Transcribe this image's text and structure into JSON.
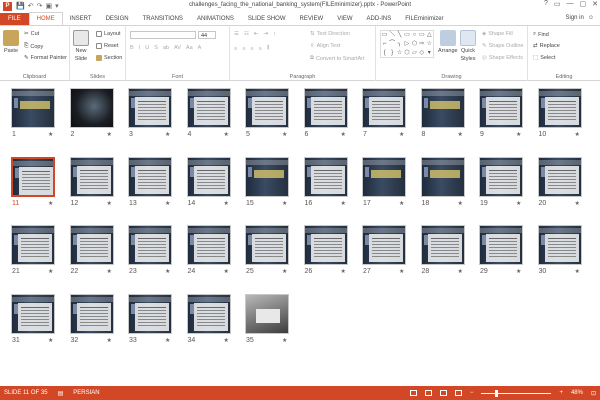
{
  "window": {
    "title": "challenges_facing_the_national_banking_system(FILEminimizer).pptx - PowerPoint",
    "app_icon": "P",
    "qat": [
      "💾",
      "↶",
      "↷",
      "▣",
      "▾"
    ],
    "controls": [
      "?",
      "▭",
      "—",
      "▢",
      "✕"
    ]
  },
  "tabs": [
    "FILE",
    "HOME",
    "INSERT",
    "DESIGN",
    "TRANSITIONS",
    "ANIMATIONS",
    "SLIDE SHOW",
    "REVIEW",
    "VIEW",
    "ADD-INS",
    "FILEminimizer"
  ],
  "active_tab": "HOME",
  "signin": "Sign in",
  "ribbon": {
    "clipboard": {
      "label": "Clipboard",
      "paste": "Paste",
      "cut": "Cut",
      "copy": "Copy",
      "format_painter": "Format Painter"
    },
    "slides": {
      "label": "Slides",
      "new_slide": "New",
      "new_slide2": "Slide",
      "layout": "Layout",
      "reset": "Reset",
      "section": "Section"
    },
    "font": {
      "label": "Font",
      "size": "44"
    },
    "paragraph": {
      "label": "Paragraph",
      "text_direction": "Text Direction",
      "align_text": "Align Text",
      "smartart": "Convert to SmartArt"
    },
    "drawing": {
      "label": "Drawing",
      "arrange": "Arrange",
      "quick_styles": "Quick",
      "quick_styles2": "Styles",
      "shape_fill": "Shape Fill",
      "shape_outline": "Shape Outline",
      "shape_effects": "Shape Effects"
    },
    "editing": {
      "label": "Editing",
      "find": "Find",
      "replace": "Replace",
      "select": "Select"
    }
  },
  "slides": [
    {
      "n": "1",
      "t": "title"
    },
    {
      "n": "2",
      "t": "dark"
    },
    {
      "n": "3",
      "t": "text"
    },
    {
      "n": "4",
      "t": "text"
    },
    {
      "n": "5",
      "t": "text"
    },
    {
      "n": "6",
      "t": "text"
    },
    {
      "n": "7",
      "t": "text"
    },
    {
      "n": "8",
      "t": "title"
    },
    {
      "n": "9",
      "t": "text"
    },
    {
      "n": "10",
      "t": "text"
    },
    {
      "n": "11",
      "t": "text"
    },
    {
      "n": "12",
      "t": "text"
    },
    {
      "n": "13",
      "t": "text"
    },
    {
      "n": "14",
      "t": "text"
    },
    {
      "n": "15",
      "t": "title"
    },
    {
      "n": "16",
      "t": "text"
    },
    {
      "n": "17",
      "t": "title"
    },
    {
      "n": "18",
      "t": "title"
    },
    {
      "n": "19",
      "t": "text"
    },
    {
      "n": "20",
      "t": "text"
    },
    {
      "n": "21",
      "t": "text"
    },
    {
      "n": "22",
      "t": "text"
    },
    {
      "n": "23",
      "t": "text"
    },
    {
      "n": "24",
      "t": "text"
    },
    {
      "n": "25",
      "t": "text"
    },
    {
      "n": "26",
      "t": "text"
    },
    {
      "n": "27",
      "t": "text"
    },
    {
      "n": "28",
      "t": "text"
    },
    {
      "n": "29",
      "t": "text"
    },
    {
      "n": "30",
      "t": "text"
    },
    {
      "n": "31",
      "t": "text"
    },
    {
      "n": "32",
      "t": "text"
    },
    {
      "n": "33",
      "t": "text"
    },
    {
      "n": "34",
      "t": "text"
    },
    {
      "n": "35",
      "t": "photo"
    }
  ],
  "selected_slide": "11",
  "star_glyph": "★",
  "status": {
    "slide_info": "SLIDE 11 OF 35",
    "language": "PERSIAN",
    "zoom": "48%",
    "zoom_minus": "−",
    "zoom_plus": "+"
  },
  "colors": {
    "accent": "#d24726"
  }
}
